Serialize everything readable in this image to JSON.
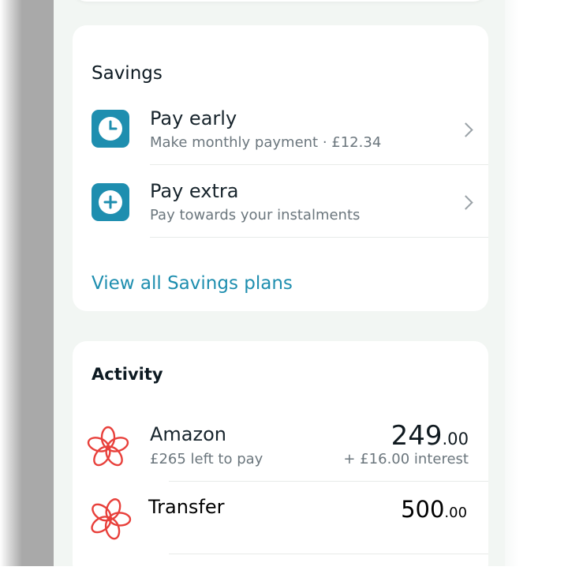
{
  "savings": {
    "title": "Savings",
    "items": [
      {
        "title": "Pay early",
        "subtitle": "Make monthly payment · £12.34",
        "icon": "clock-icon"
      },
      {
        "title": "Pay extra",
        "subtitle": "Pay towards your instalments",
        "icon": "plus-circle-icon"
      }
    ],
    "link": "View all Savings plans"
  },
  "activity": {
    "title": "Activity",
    "items": [
      {
        "merchant": "Amazon",
        "subtitle": "£265 left to pay",
        "amount_main": "249",
        "amount_dec": ".00",
        "note": "+ £16.00 interest",
        "icon": "flower-logo-icon"
      },
      {
        "merchant": "Transfer",
        "amount_main": "500",
        "amount_dec": ".00",
        "icon": "flower-logo-icon"
      }
    ]
  },
  "colors": {
    "accent": "#1e8eaf",
    "brand_red": "#e8403b",
    "background": "#f2f6f3"
  }
}
